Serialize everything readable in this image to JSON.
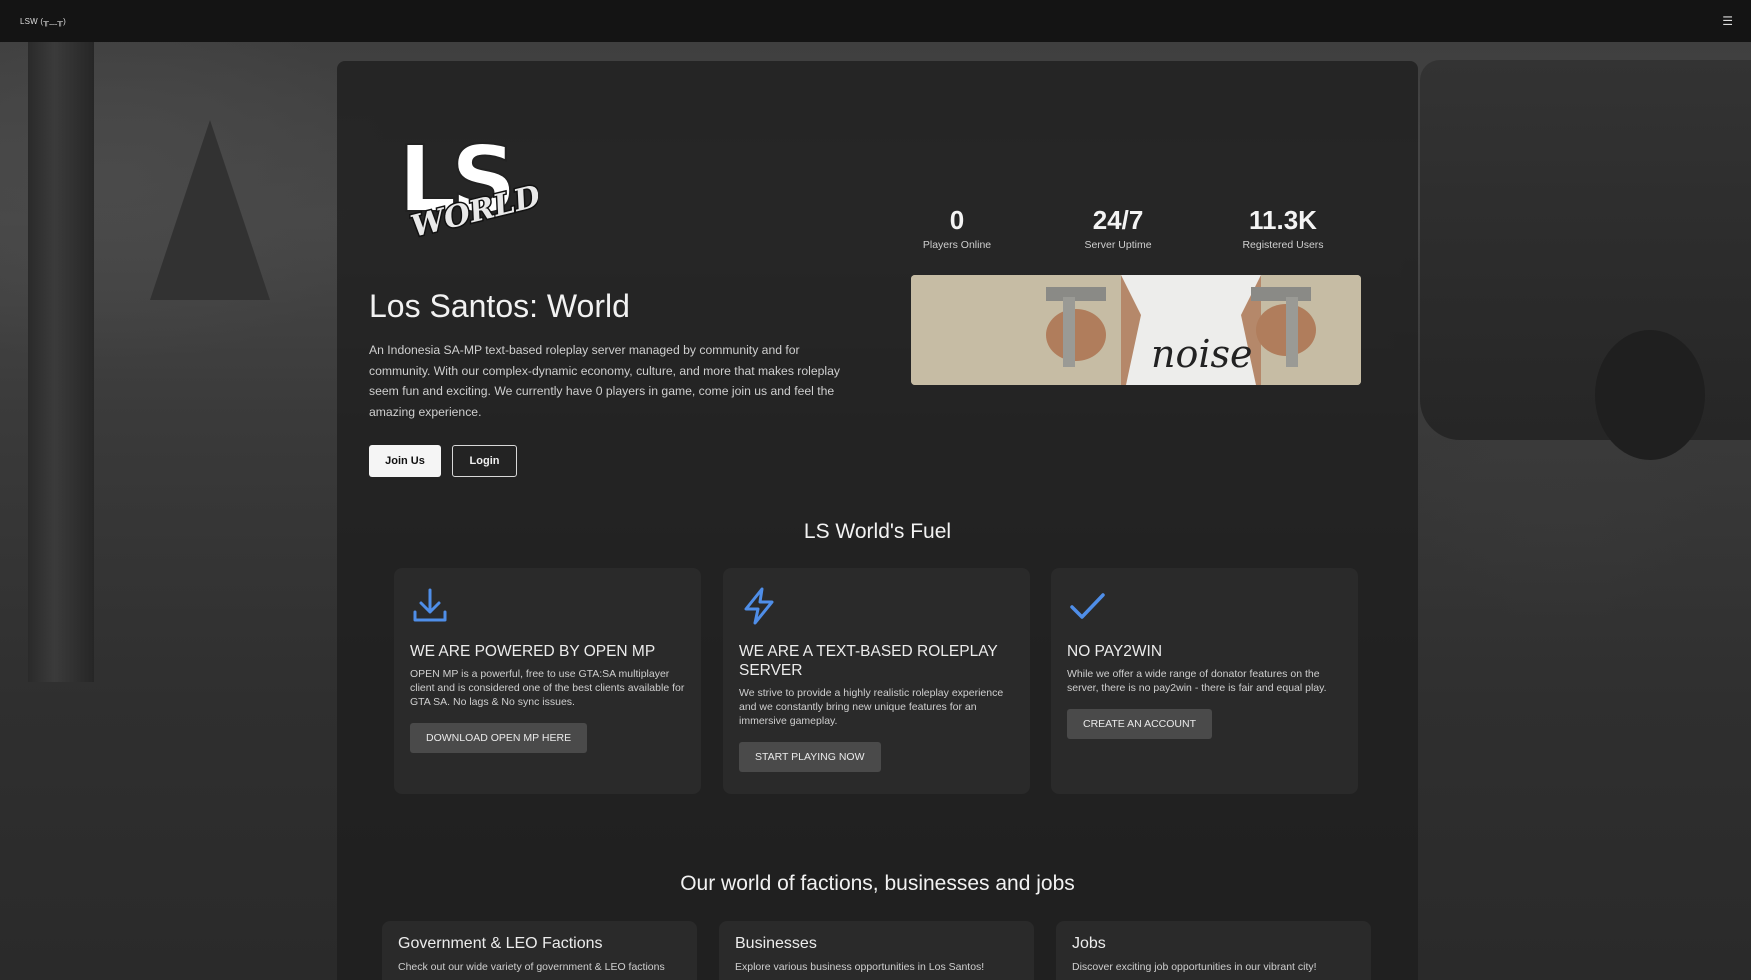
{
  "nav": {
    "brand": "LSW (╥﹏╥)",
    "menu_icon": "☰"
  },
  "hero": {
    "logo_text": "LS WORLD",
    "title": "Los Santos: World",
    "description": "An Indonesia SA-MP text-based roleplay server managed by community and for community. With our complex-dynamic economy, culture, and more that makes roleplay seem fun and exciting. We currently have 0 players in game, come join us and feel the amazing experience.",
    "join_label": "Join Us",
    "login_label": "Login"
  },
  "stats": [
    {
      "value": "0",
      "label": "Players Online"
    },
    {
      "value": "24/7",
      "label": "Server Uptime"
    },
    {
      "value": "11.3K",
      "label": "Registered Users"
    }
  ],
  "fuel": {
    "title": "LS World's Fuel",
    "accent_color": "#4f8ee8",
    "cards": [
      {
        "icon": "download-icon",
        "heading": "WE ARE POWERED BY OPEN MP",
        "text": "OPEN MP is a powerful, free to use GTA:SA multiplayer client and is considered one of the best clients available for GTA SA. No lags & No sync issues.",
        "button": "DOWNLOAD OPEN MP HERE"
      },
      {
        "icon": "lightning-icon",
        "heading": "WE ARE A TEXT-BASED ROLEPLAY SERVER",
        "text": "We strive to provide a highly realistic roleplay experience and we constantly bring new unique features for an immersive gameplay.",
        "button": "START PLAYING NOW"
      },
      {
        "icon": "check-icon",
        "heading": "NO PAY2WIN",
        "text": "While we offer a wide range of donator features on the server, there is no pay2win - there is fair and equal play.",
        "button": "CREATE AN ACCOUNT"
      }
    ]
  },
  "world": {
    "title": "Our world of factions, businesses and jobs",
    "categories": [
      {
        "heading": "Government & LEO Factions",
        "text": "Check out our wide variety of government & LEO factions"
      },
      {
        "heading": "Businesses",
        "text": "Explore various business opportunities in Los Santos!"
      },
      {
        "heading": "Jobs",
        "text": "Discover exciting job opportunities in our vibrant city!"
      }
    ]
  }
}
